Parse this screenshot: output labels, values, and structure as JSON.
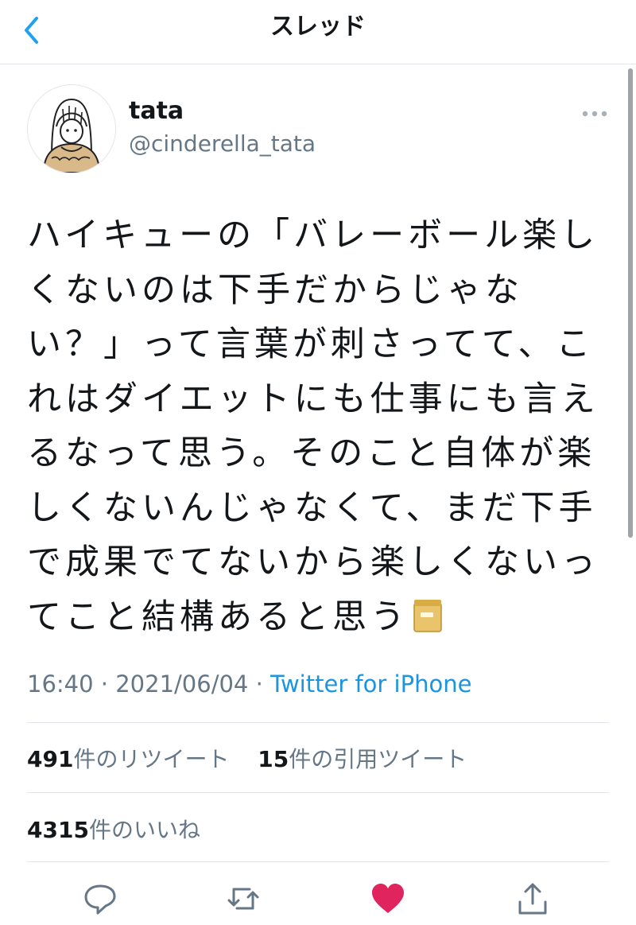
{
  "header": {
    "title": "スレッド"
  },
  "author": {
    "name": "tata",
    "handle": "@cinderella_tata"
  },
  "tweet": {
    "text": "ハイキューの「バレーボール楽しくないのは下手だからじゃない？」って言葉が刺さってて、これはダイエットにも仕事にも言えるなって思う。そのこと自体が楽しくないんじゃなくて、まだ下手で成果でてないから楽しくないってこと結構あると思う",
    "emoji": "folder-icon"
  },
  "meta": {
    "time": "16:40",
    "date": "2021/06/04",
    "source": "Twitter for iPhone",
    "dot": "·"
  },
  "stats": {
    "retweets_count": "491",
    "retweets_label": "件のリツイート",
    "quotes_count": "15",
    "quotes_label": "件の引用ツイート",
    "likes_count": "4315",
    "likes_label": "件のいいね"
  },
  "colors": {
    "accent": "#1b95e0",
    "like": "#e0245e",
    "muted": "#657786"
  }
}
